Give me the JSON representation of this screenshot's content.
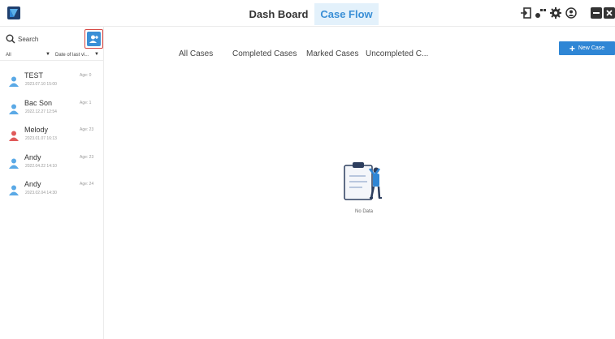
{
  "header": {
    "tabs": [
      {
        "label": "Dash Board",
        "active": false
      },
      {
        "label": "Case Flow",
        "active": true
      }
    ],
    "icons": [
      "import-icon",
      "share-icon",
      "settings-icon",
      "account-icon",
      "minimize-icon",
      "close-icon"
    ]
  },
  "sidebar": {
    "search_placeholder": "Search",
    "filter": {
      "group": "All",
      "sort": "Date of last vi..."
    },
    "cases": [
      {
        "name": "TEST",
        "date": "2023.07.10 15:00",
        "age": "Age: 0",
        "gender": "male"
      },
      {
        "name": "Bac Son",
        "date": "2022.12.27 12:54",
        "age": "Age: 1",
        "gender": "male"
      },
      {
        "name": "Melody",
        "date": "2023.01.07 16:13",
        "age": "Age: 23",
        "gender": "female"
      },
      {
        "name": "Andy",
        "date": "2022.04.22 14:10",
        "age": "Age: 23",
        "gender": "male"
      },
      {
        "name": "Andy",
        "date": "2023.02.04 14:30",
        "age": "Age: 24",
        "gender": "male"
      }
    ]
  },
  "main": {
    "tabs": [
      "All Cases",
      "Completed Cases",
      "Marked Cases",
      "Uncompleted C..."
    ],
    "new_case_label": "New Case",
    "empty_text": "No Data"
  },
  "colors": {
    "accent": "#2f86d5",
    "active_tab_bg": "#e3f1fb",
    "male_avatar": "#5aa9e6",
    "female_avatar": "#e05a5a",
    "highlight_border": "#d64541"
  }
}
